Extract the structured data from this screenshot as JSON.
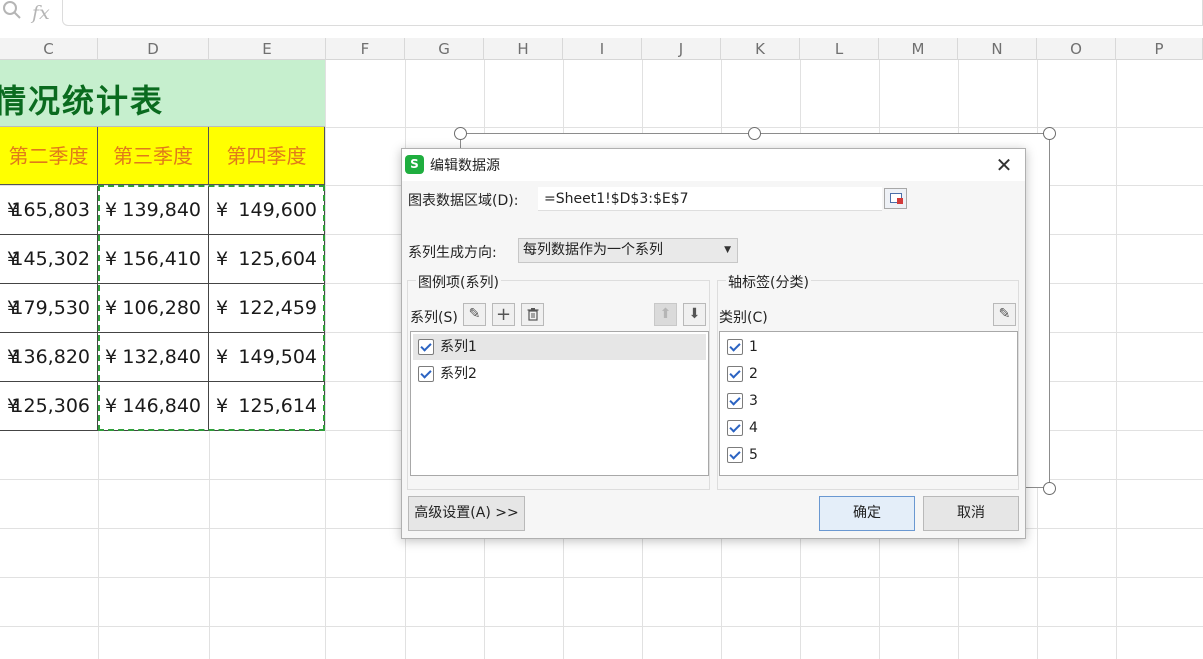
{
  "formula_bar": {
    "zoom_icon": "zoom-icon",
    "fx_label": "fx",
    "value": ""
  },
  "columns": [
    "C",
    "D",
    "E",
    "F",
    "G",
    "H",
    "I",
    "J",
    "K",
    "L",
    "M",
    "N",
    "O",
    "P"
  ],
  "sheet": {
    "title": "情况统计表",
    "quarter_headers": [
      "第二季度",
      "第三季度",
      "第四季度"
    ],
    "currency_symbol": "¥",
    "rows": [
      [
        "165,803",
        "139,840",
        "149,600"
      ],
      [
        "145,302",
        "156,410",
        "125,604"
      ],
      [
        "179,530",
        "106,280",
        "122,459"
      ],
      [
        "136,820",
        "132,840",
        "149,504"
      ],
      [
        "125,306",
        "146,840",
        "125,614"
      ]
    ],
    "colors": {
      "title_bg": "#c6efce",
      "title_text": "#0a6b1f",
      "header_bg": "#ffff00",
      "header_text": "#e07a1a",
      "selection_border": "#2e9e3a"
    }
  },
  "dialog": {
    "app_icon_letter": "S",
    "title": "编辑数据源",
    "close_label": "✕",
    "range_label": "图表数据区域(D):",
    "range_value": "=Sheet1!$D$3:$E$7",
    "direction_label": "系列生成方向:",
    "direction_value": "每列数据作为一个系列",
    "legend_group_title": "图例项(系列)",
    "series_label": "系列(S)",
    "series_items": [
      {
        "label": "系列1",
        "checked": true,
        "selected": true
      },
      {
        "label": "系列2",
        "checked": true,
        "selected": false
      }
    ],
    "axis_group_title": "轴标签(分类)",
    "category_label": "类别(C)",
    "category_items": [
      {
        "label": "1",
        "checked": true
      },
      {
        "label": "2",
        "checked": true
      },
      {
        "label": "3",
        "checked": true
      },
      {
        "label": "4",
        "checked": true
      },
      {
        "label": "5",
        "checked": true
      }
    ],
    "advanced_button": "高级设置(A) >>",
    "ok_button": "确定",
    "cancel_button": "取消",
    "icons": {
      "edit": "pencil-icon",
      "add": "plus-icon",
      "delete": "trash-icon",
      "up": "arrow-up-icon",
      "down": "arrow-down-icon",
      "range_picker": "range-picker-icon"
    }
  }
}
